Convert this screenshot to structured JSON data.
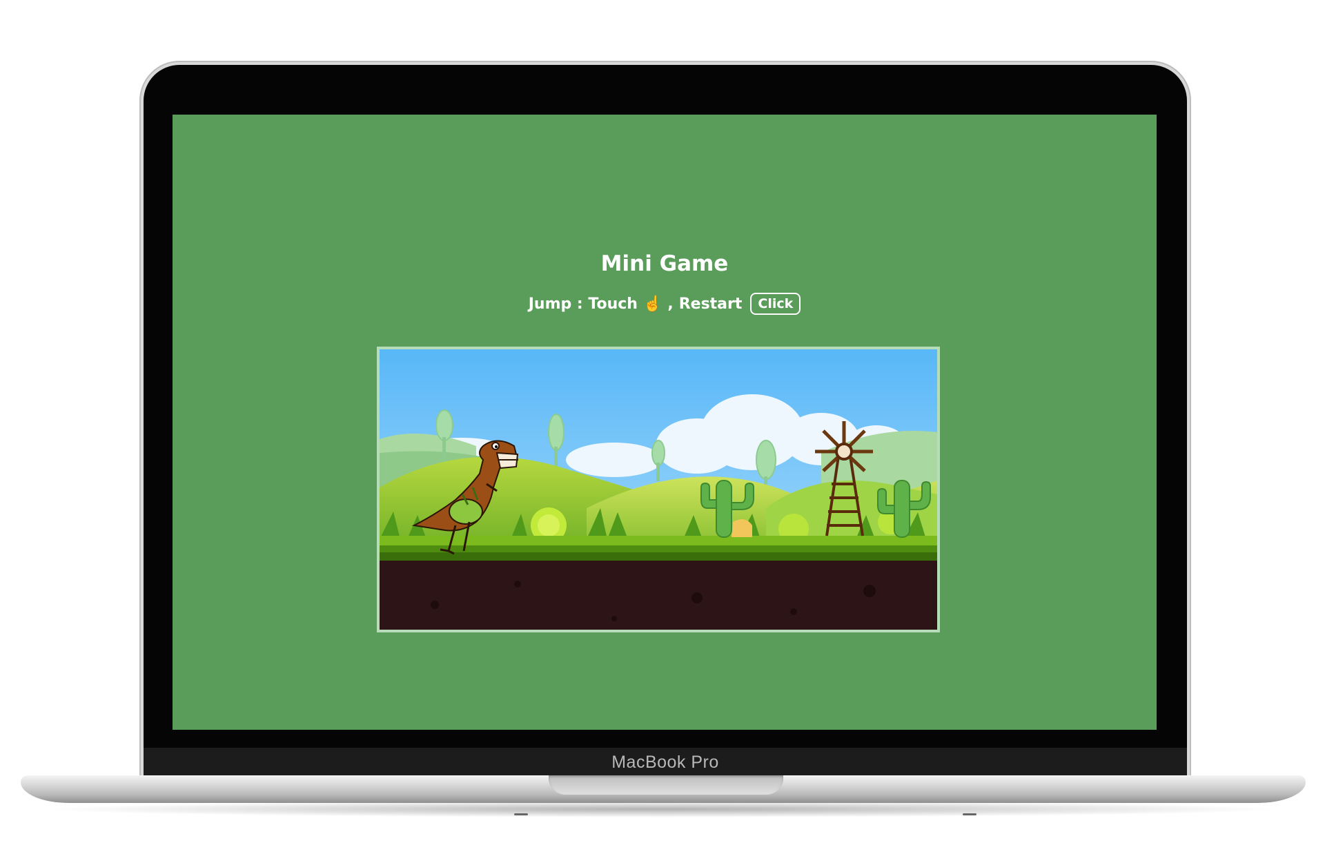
{
  "device": {
    "brand_label": "MacBook Pro"
  },
  "page": {
    "title": "Mini Game",
    "instructions": {
      "jump_label": "Jump : Touch",
      "jump_icon": "pointing-up-hand-icon",
      "separator": ",",
      "restart_label": "Restart",
      "restart_button": "Click"
    }
  },
  "game": {
    "player": "dinosaur",
    "obstacles": [
      "cactus",
      "cactus"
    ],
    "scenery": [
      "windmill",
      "hills",
      "clouds",
      "trees"
    ]
  },
  "colors": {
    "page_background": "#5a9c5a",
    "text": "#ffffff",
    "frame_border": "#b7dcb8",
    "sky": "#5ab9f5",
    "soil": "#2d1517"
  }
}
